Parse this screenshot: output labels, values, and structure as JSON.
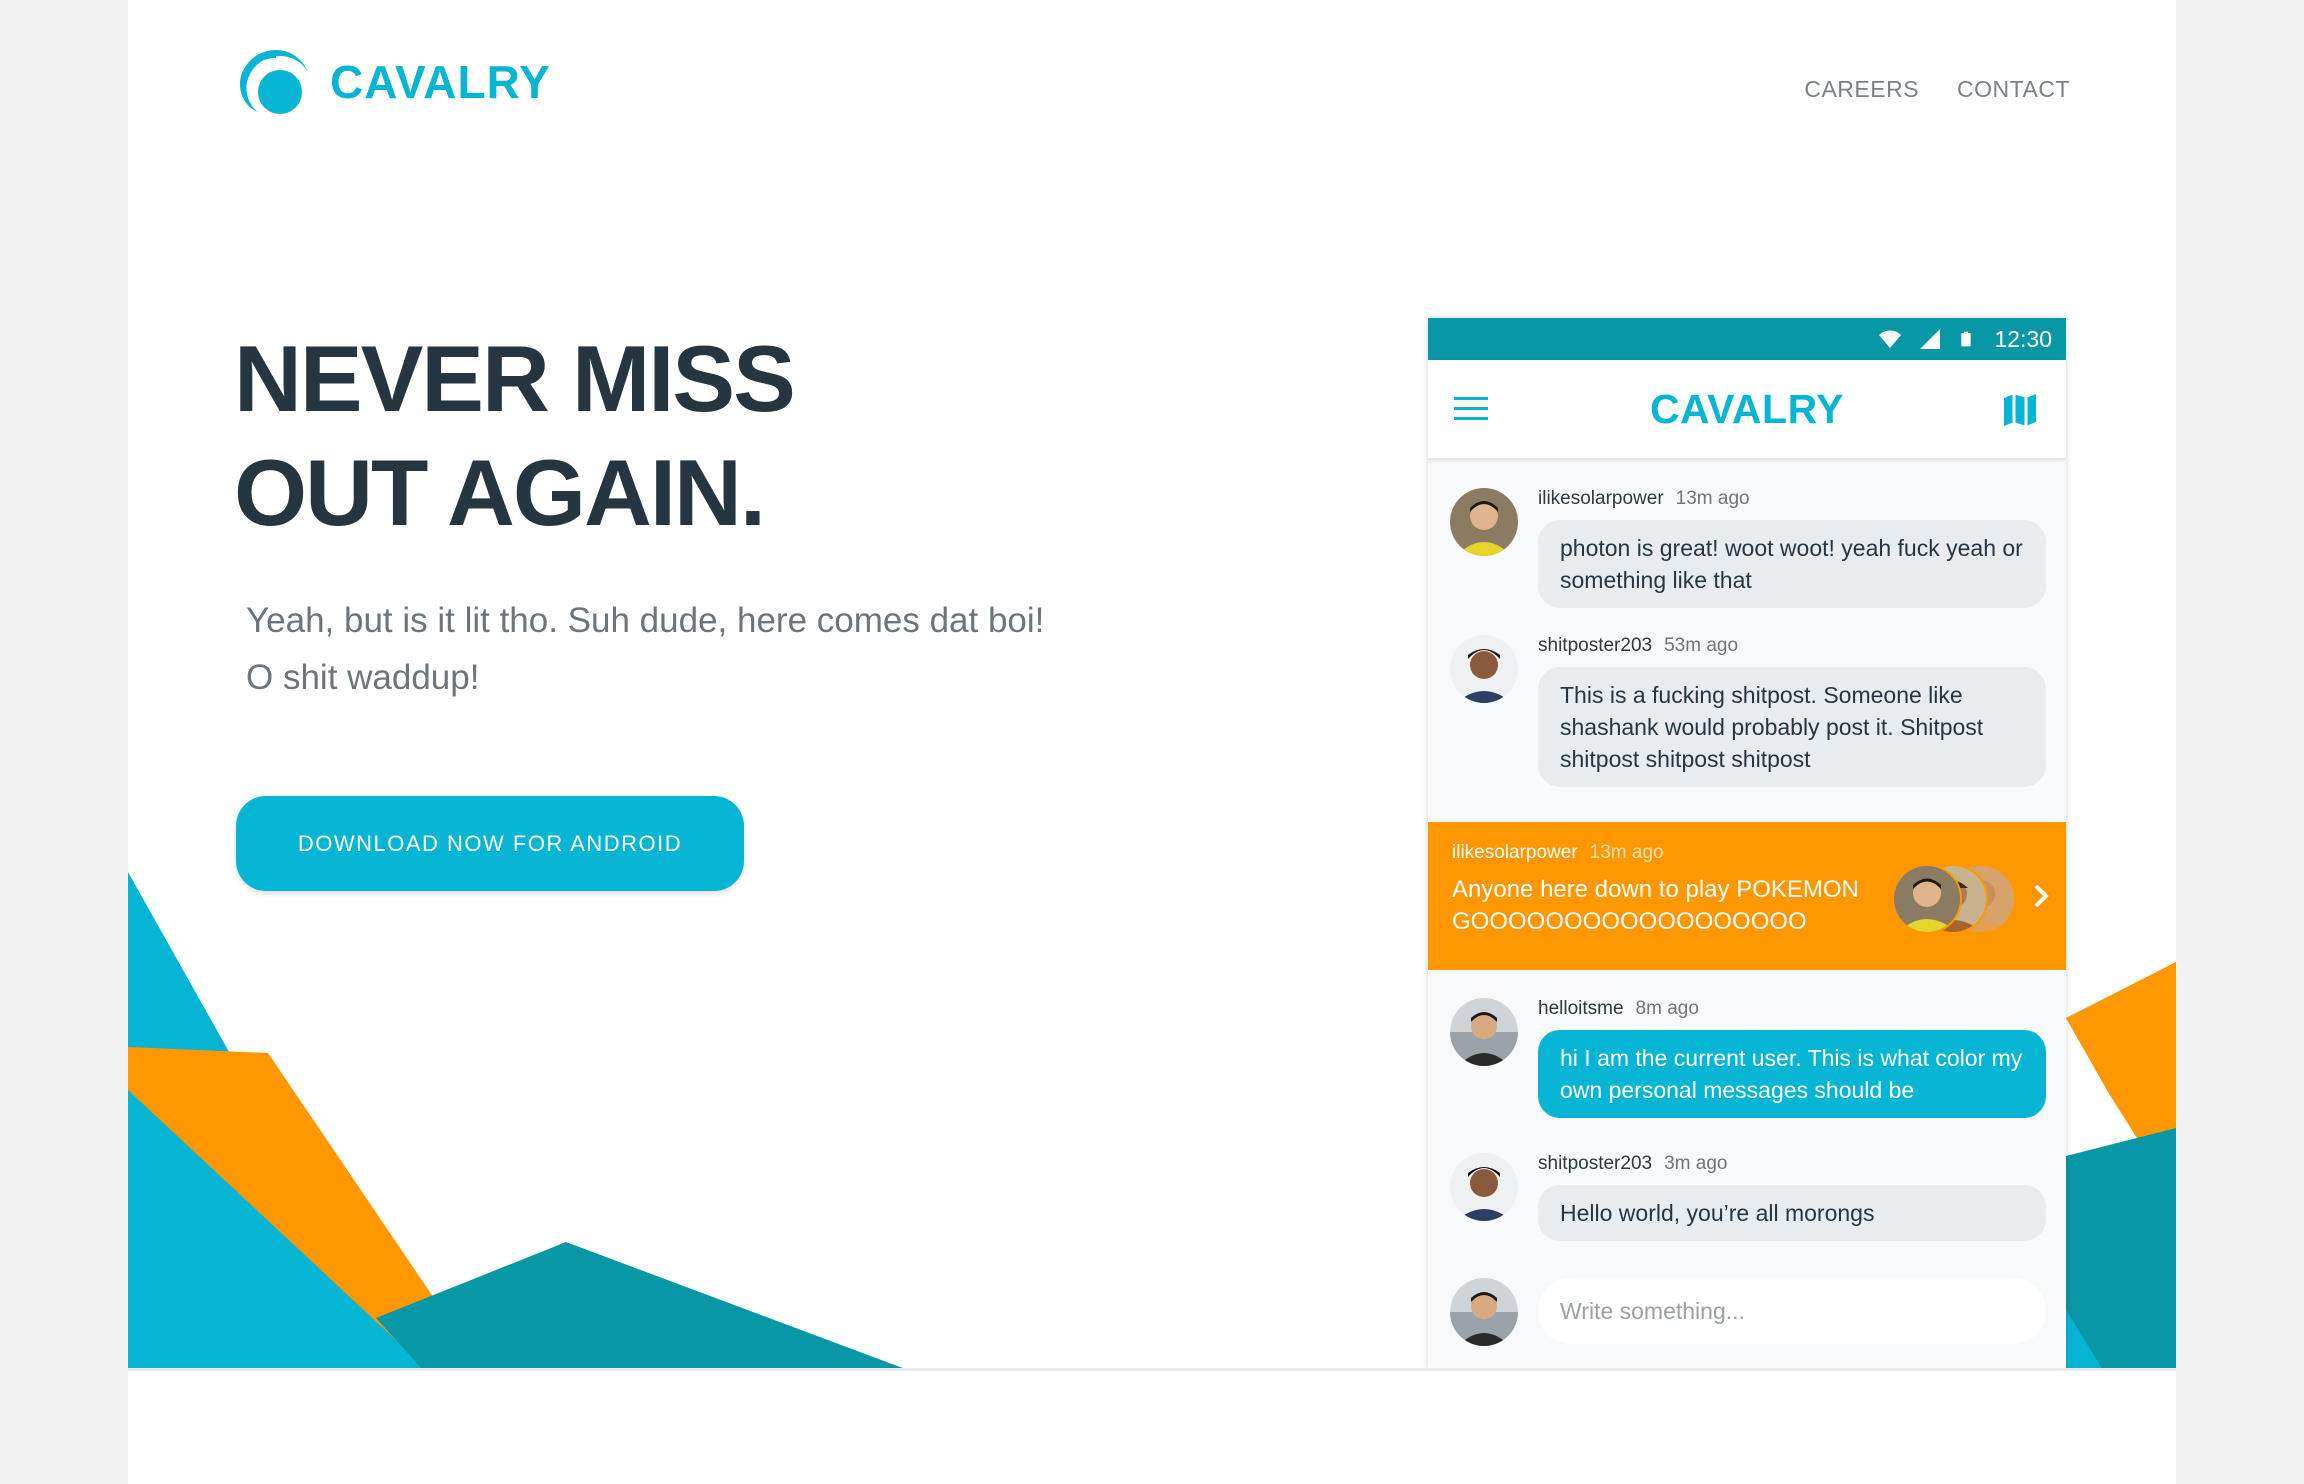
{
  "brand": {
    "name": "CAVALRY",
    "accent": "#06b5d3",
    "orange": "#ff9800",
    "teal": "#0797a5",
    "dark_text": "#263640"
  },
  "nav": {
    "items": [
      {
        "label": "CAREERS"
      },
      {
        "label": "CONTACT"
      }
    ]
  },
  "hero": {
    "headline_line1": "NEVER MISS",
    "headline_line2": "OUT AGAIN.",
    "sub_line1": "Yeah, but is it lit tho. Suh dude, here comes dat boi!",
    "sub_line2": "O shit waddup!",
    "cta_label": "DOWNLOAD NOW FOR ANDROID"
  },
  "phone": {
    "status": {
      "time": "12:30",
      "icons": [
        "wifi-icon",
        "signal-icon",
        "battery-icon"
      ]
    },
    "app_title": "CAVALRY",
    "toolbar_icons": [
      "menu-icon",
      "map-icon"
    ],
    "messages": [
      {
        "user": "ilikesolarpower",
        "time": "13m ago",
        "text": "photon is great! woot woot! yeah fuck yeah or something like that",
        "mine": false
      },
      {
        "user": "shitposter203",
        "time": "53m ago",
        "text": "This is a fucking shitpost. Someone like shashank would probably post it. Shitpost shitpost shitpost shitpost",
        "mine": false
      },
      {
        "user": "helloitsme",
        "time": "8m ago",
        "text": "hi I am the current user. This is what color my own personal messages should be",
        "mine": true
      },
      {
        "user": "shitposter203",
        "time": "3m ago",
        "text": "Hello world, you’re all morongs",
        "mine": false
      }
    ],
    "event": {
      "user": "ilikesolarpower",
      "time": "13m ago",
      "text": "Anyone here down to play POKEMON GOOOOOOOOOOOOOOOOOO"
    },
    "composer_placeholder": "Write something..."
  }
}
